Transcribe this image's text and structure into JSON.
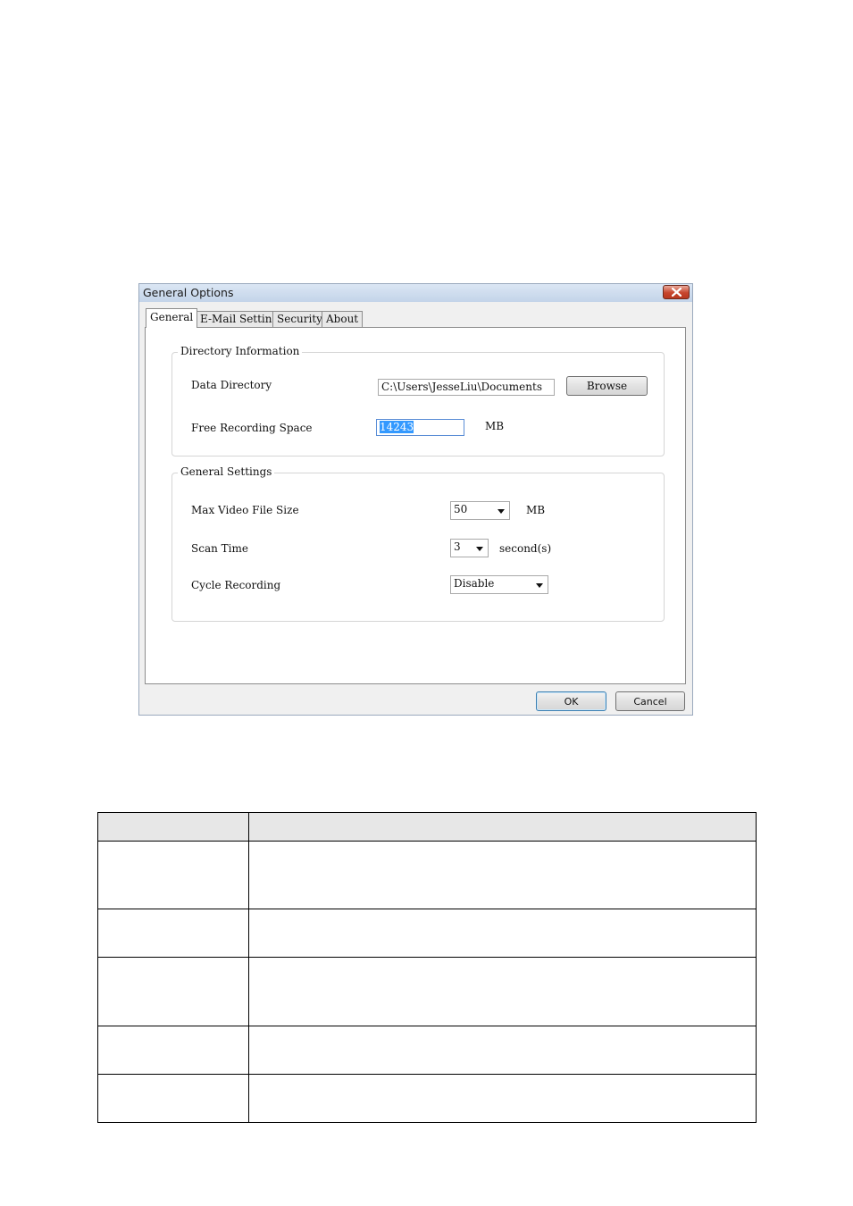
{
  "dialog": {
    "title": "General Options",
    "tabs": [
      {
        "label": "General",
        "active": true
      },
      {
        "label": "E-Mail Setting",
        "active": false
      },
      {
        "label": "Security",
        "active": false
      },
      {
        "label": "About",
        "active": false
      }
    ],
    "directory_info": {
      "legend": "Directory Information",
      "data_directory_label": "Data Directory",
      "data_directory_value": "C:\\Users\\JesseLiu\\Documents",
      "browse_label": "Browse",
      "free_space_label": "Free Recording Space",
      "free_space_value": "14243",
      "free_space_unit": "MB"
    },
    "general_settings": {
      "legend": "General Settings",
      "max_file_size_label": "Max Video File Size",
      "max_file_size_value": "50",
      "max_file_size_unit": "MB",
      "scan_time_label": "Scan Time",
      "scan_time_value": "3",
      "scan_time_unit": "second(s)",
      "cycle_recording_label": "Cycle Recording",
      "cycle_recording_value": "Disable"
    },
    "ok_label": "OK",
    "cancel_label": "Cancel"
  },
  "doc_table": {
    "rows": 5
  }
}
